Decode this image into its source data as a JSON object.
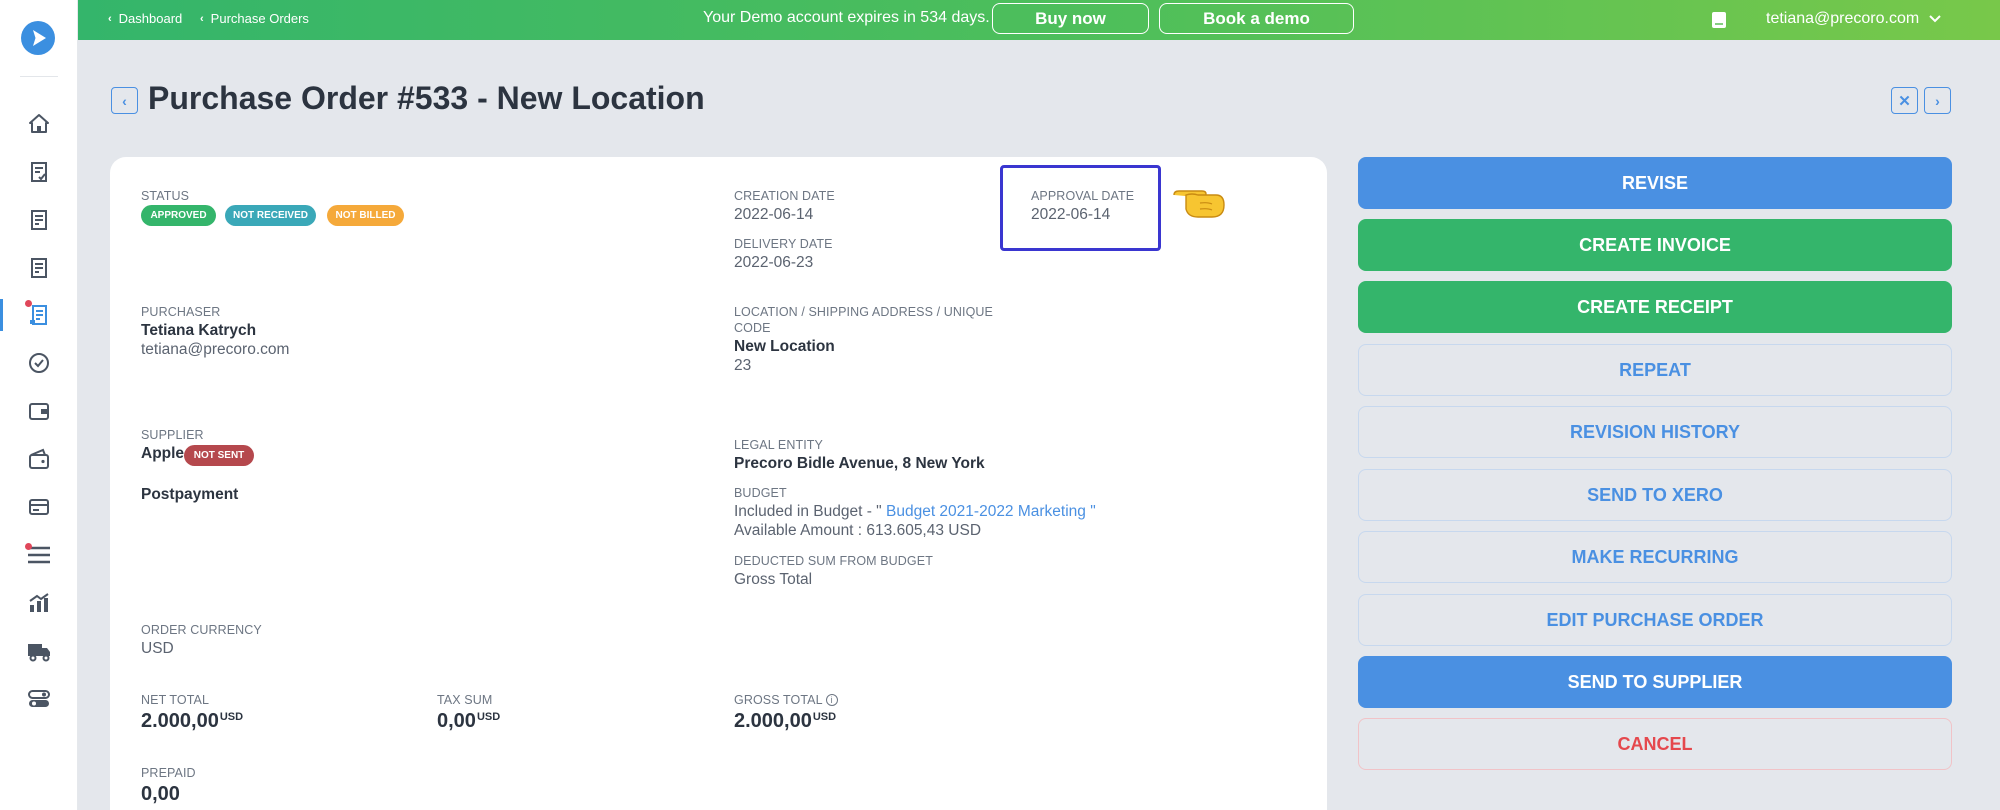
{
  "topbar": {
    "breadcrumbs": [
      "Dashboard",
      "Purchase Orders"
    ],
    "demo_text": "Your Demo account expires in 534 days.",
    "buy_now": "Buy now",
    "book_demo": "Book a demo",
    "user_email": "tetiana@precoro.com",
    "gradient_start": "#34b56b",
    "gradient_end": "#78c84a"
  },
  "sidebar": {
    "logo_icon": "precoro-logo",
    "items": [
      {
        "icon": "home-icon",
        "active": false,
        "dot": false
      },
      {
        "icon": "requisition-icon",
        "active": false,
        "dot": false
      },
      {
        "icon": "document-icon",
        "active": false,
        "dot": false
      },
      {
        "icon": "document-icon",
        "active": false,
        "dot": false
      },
      {
        "icon": "purchase-order-icon",
        "active": true,
        "dot": true
      },
      {
        "icon": "check-circle-icon",
        "active": false,
        "dot": false
      },
      {
        "icon": "wallet-icon",
        "active": false,
        "dot": false
      },
      {
        "icon": "wallet-open-icon",
        "active": false,
        "dot": false
      },
      {
        "icon": "card-icon",
        "active": false,
        "dot": false
      },
      {
        "icon": "list-icon",
        "active": false,
        "dot": true
      },
      {
        "icon": "analytics-icon",
        "active": false,
        "dot": false
      },
      {
        "icon": "delivery-truck-icon",
        "active": false,
        "dot": false
      },
      {
        "icon": "toggles-icon",
        "active": false,
        "dot": false
      }
    ]
  },
  "page": {
    "title": "Purchase Order #533 - New Location"
  },
  "details": {
    "status_label": "STATUS",
    "badges": [
      {
        "text": "APPROVED",
        "color": "#34b56b"
      },
      {
        "text": "NOT RECEIVED",
        "color": "#3aa8b8"
      },
      {
        "text": "NOT BILLED",
        "color": "#f5a93a"
      }
    ],
    "creation_date_label": "CREATION DATE",
    "creation_date": "2022-06-14",
    "delivery_date_label": "DELIVERY DATE",
    "delivery_date": "2022-06-23",
    "approval_date_label": "APPROVAL DATE",
    "approval_date": "2022-06-14",
    "purchaser_label": "PURCHASER",
    "purchaser_name": "Tetiana Katrych",
    "purchaser_email": "tetiana@precoro.com",
    "location_label_1": "LOCATION / SHIPPING ADDRESS / UNIQUE",
    "location_label_2": "CODE",
    "location_name": "New Location",
    "location_code": "23",
    "supplier_label": "SUPPLIER",
    "supplier_name": "Apple",
    "supplier_badge": "NOT SENT",
    "supplier_badge_color": "#b5484d",
    "payment_terms": "Postpayment",
    "legal_entity_label": "LEGAL ENTITY",
    "legal_entity": "Precoro Bidle Avenue, 8 New York",
    "budget_label": "BUDGET",
    "budget_prefix": "Included in Budget - \" ",
    "budget_link": "Budget 2021-2022 Marketing",
    "budget_suffix": " \"",
    "available_amount": "Available Amount : 613.605,43 USD",
    "deducted_label": "DEDUCTED SUM FROM BUDGET",
    "deducted_value": "Gross Total",
    "currency_label": "ORDER CURRENCY",
    "currency": "USD",
    "net_total_label": "NET TOTAL",
    "net_total": "2.000,00",
    "net_total_unit": "USD",
    "tax_sum_label": "TAX SUM",
    "tax_sum": "0,00",
    "tax_sum_unit": "USD",
    "gross_total_label": "GROSS TOTAL",
    "gross_total": "2.000,00",
    "gross_total_unit": "USD",
    "prepaid_label": "PREPAID",
    "prepaid": "0,00"
  },
  "actions": {
    "revise": "REVISE",
    "create_invoice": "CREATE INVOICE",
    "create_receipt": "CREATE RECEIPT",
    "repeat": "REPEAT",
    "revision_history": "REVISION HISTORY",
    "send_to_xero": "SEND TO XERO",
    "make_recurring": "MAKE RECURRING",
    "edit_purchase_order": "EDIT PURCHASE ORDER",
    "send_to_supplier": "SEND TO SUPPLIER",
    "cancel": "CANCEL"
  },
  "colors": {
    "accent_blue": "#4a90e2",
    "accent_green": "#34b56b",
    "danger_red": "#e5484d",
    "highlight_box": "#3a36d0"
  }
}
